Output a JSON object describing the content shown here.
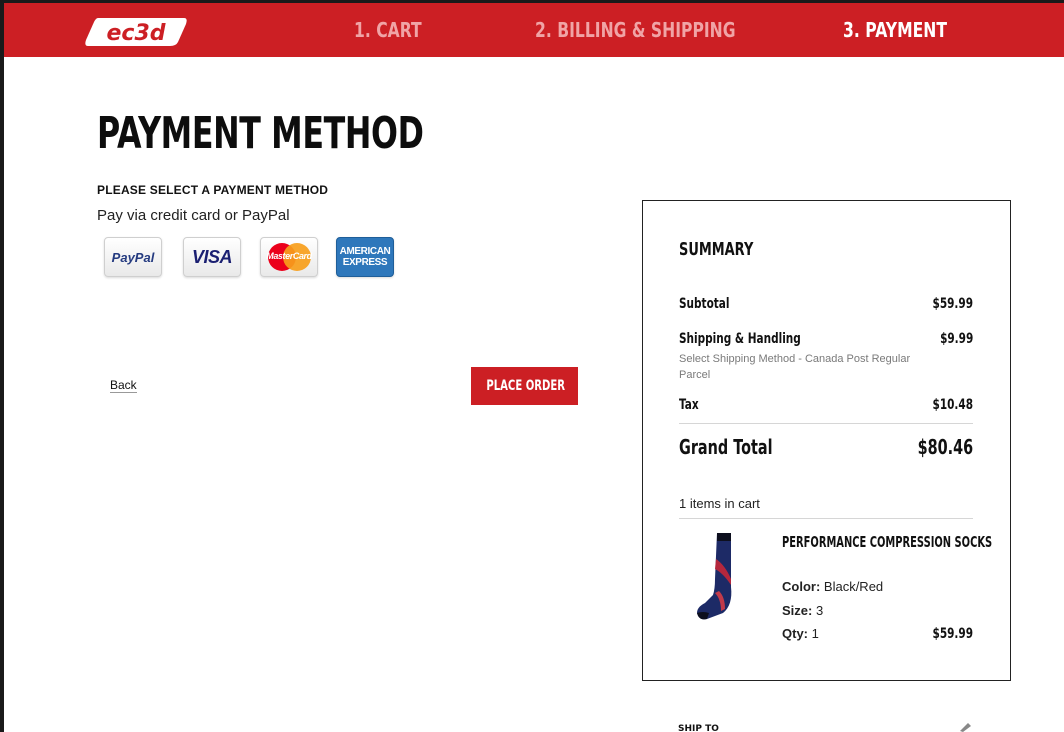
{
  "header": {
    "logo_text": "ec3d",
    "steps": [
      {
        "label": "1. CART",
        "state": "inactive"
      },
      {
        "label": "2. BILLING & SHIPPING",
        "state": "inactive"
      },
      {
        "label": "3. PAYMENT",
        "state": "active"
      }
    ]
  },
  "colors": {
    "brand_red": "#cc1f24",
    "inactive_step": "#f0a4a6",
    "text_dark": "#111111"
  },
  "main": {
    "title": "PAYMENT METHOD",
    "section_label": "PLEASE SELECT A PAYMENT METHOD",
    "subtext": "Pay via credit card or PayPal",
    "payment_methods": [
      {
        "name": "PayPal",
        "icon": "paypal-icon"
      },
      {
        "name": "VISA",
        "icon": "visa-icon"
      },
      {
        "name": "MasterCard",
        "icon": "mastercard-icon"
      },
      {
        "name": "AMERICAN EXPRESS",
        "icon": "amex-icon"
      }
    ],
    "back_label": "Back",
    "place_order_label": "PLACE ORDER"
  },
  "summary": {
    "title": "SUMMARY",
    "subtotal_label": "Subtotal",
    "subtotal_value": "$59.99",
    "shipping_label": "Shipping & Handling",
    "shipping_value": "$9.99",
    "shipping_method": "Select Shipping Method - Canada Post Regular Parcel",
    "tax_label": "Tax",
    "tax_value": "$10.48",
    "grand_total_label": "Grand Total",
    "grand_total_value": "$80.46",
    "items_count": "1 items in cart",
    "item": {
      "name": "PERFORMANCE COMPRESSION SOCKS",
      "color_label": "Color:",
      "color_value": "Black/Red",
      "size_label": "Size:",
      "size_value": "3",
      "qty_label": "Qty:",
      "qty_value": "1",
      "price": "$59.99"
    }
  },
  "ship_to_label": "SHIP TO"
}
